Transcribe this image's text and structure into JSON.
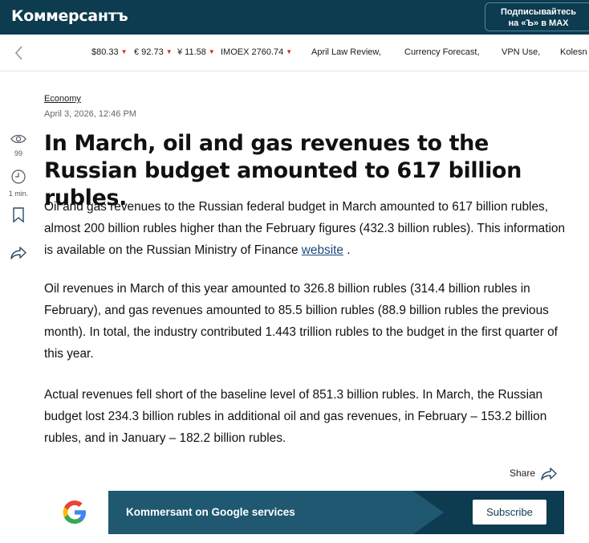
{
  "header": {
    "logo": "Коммерсантъ",
    "subscribe_line1": "Подписывайтесь",
    "subscribe_line2": "на «Ъ» в MAX"
  },
  "ticker": {
    "items": [
      {
        "label": "$80.33",
        "trend": "down"
      },
      {
        "label": "€ 92.73",
        "trend": "down"
      },
      {
        "label": "¥ 11.58",
        "trend": "down"
      },
      {
        "label": "IMOEX 2760.74",
        "trend": "down"
      }
    ],
    "links": [
      "April Law Review,",
      "Currency Forecast,",
      "VPN Use,",
      "Kolesn"
    ]
  },
  "rail": {
    "views": "99",
    "read_time": "1 min."
  },
  "article": {
    "rubric": "Economy",
    "date": "April 3, 2026, 12:46 PM",
    "title": "In March, oil and gas revenues to the Russian budget amounted to 617 billion rubles.",
    "p1_text": "Oil and gas revenues to the Russian federal budget in March amounted to 617 billion rubles, almost 200 billion rubles higher than the February figures (432.3 billion rubles). This information is available on the Russian Ministry of Finance ",
    "p1_link": "website",
    "p1_end": " .",
    "p2": "Oil revenues in March of this year amounted to 326.8 billion rubles (314.4 billion rubles in February), and gas revenues amounted to 85.5 billion rubles (88.9 billion rubles the previous month). In total, the industry contributed 1.443 trillion rubles to the budget in the first quarter of this year.",
    "p3": "Actual revenues fell short of the baseline level of 851.3 billion rubles. In March, the Russian budget lost 234.3 billion rubles in additional oil and gas revenues, in February – 153.2 billion rubles, and in January – 182.2 billion rubles.",
    "share_label": "Share"
  },
  "google_banner": {
    "text": "Kommersant on Google services",
    "button": "Subscribe"
  },
  "colors": {
    "brand_dark": "#0d3b4f",
    "down_arrow": "#d4272b"
  }
}
